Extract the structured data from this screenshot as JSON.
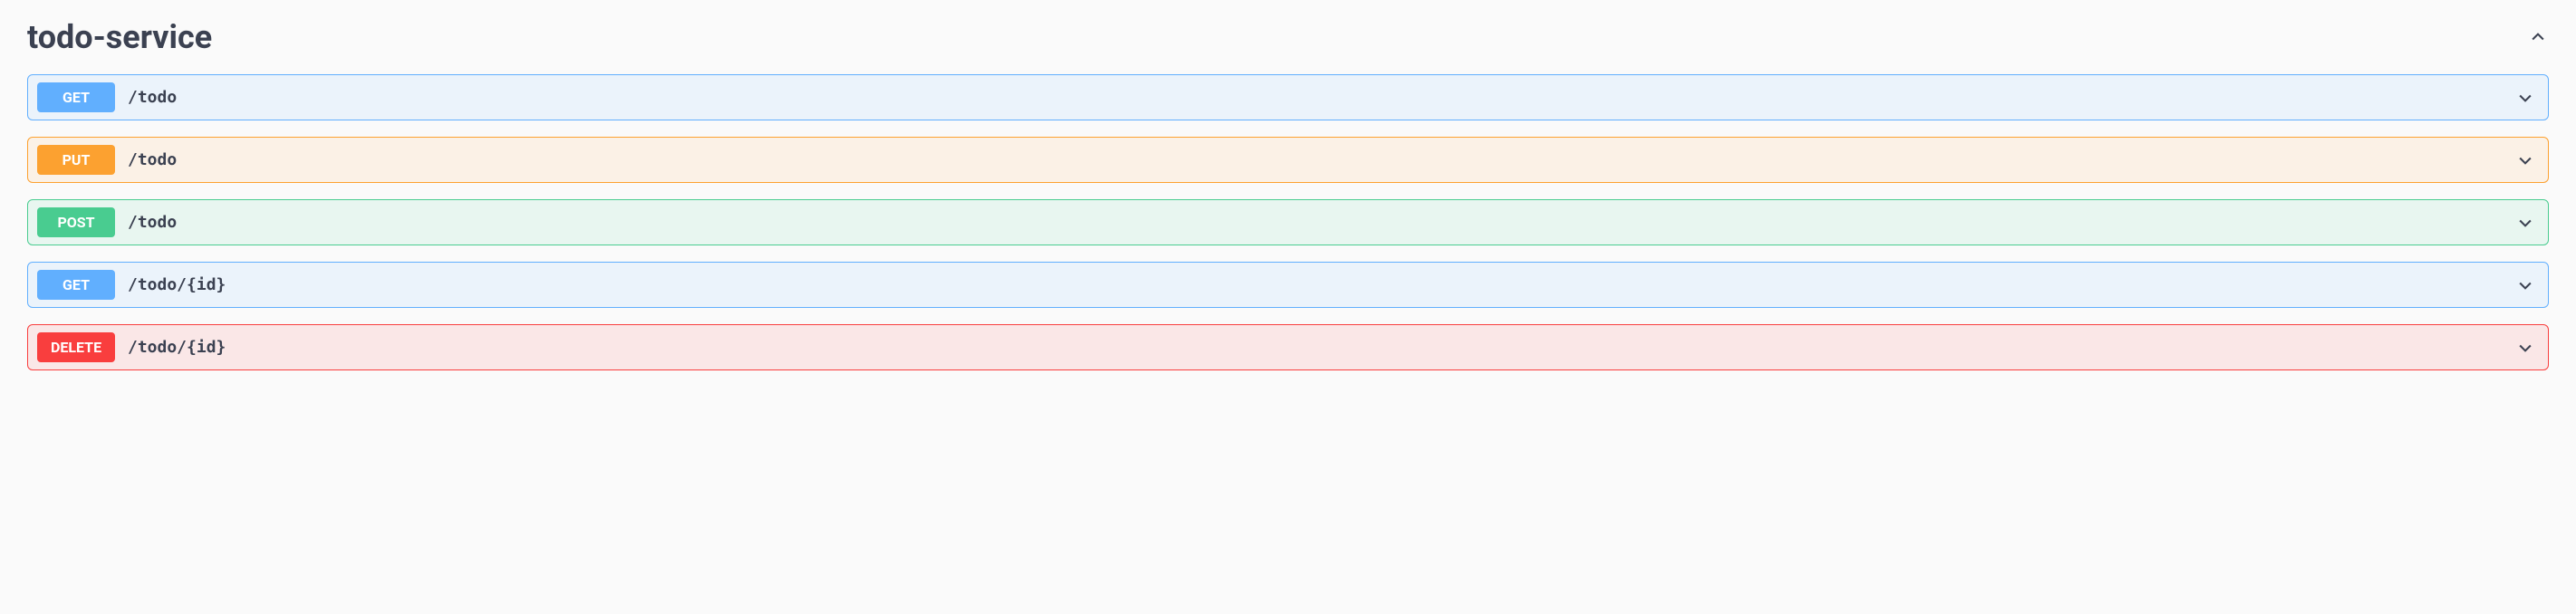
{
  "section": {
    "title": "todo-service"
  },
  "operations": [
    {
      "method": "GET",
      "path": "/todo",
      "style": "get"
    },
    {
      "method": "PUT",
      "path": "/todo",
      "style": "put"
    },
    {
      "method": "POST",
      "path": "/todo",
      "style": "post"
    },
    {
      "method": "GET",
      "path": "/todo/{id}",
      "style": "get"
    },
    {
      "method": "DELETE",
      "path": "/todo/{id}",
      "style": "delete"
    }
  ]
}
